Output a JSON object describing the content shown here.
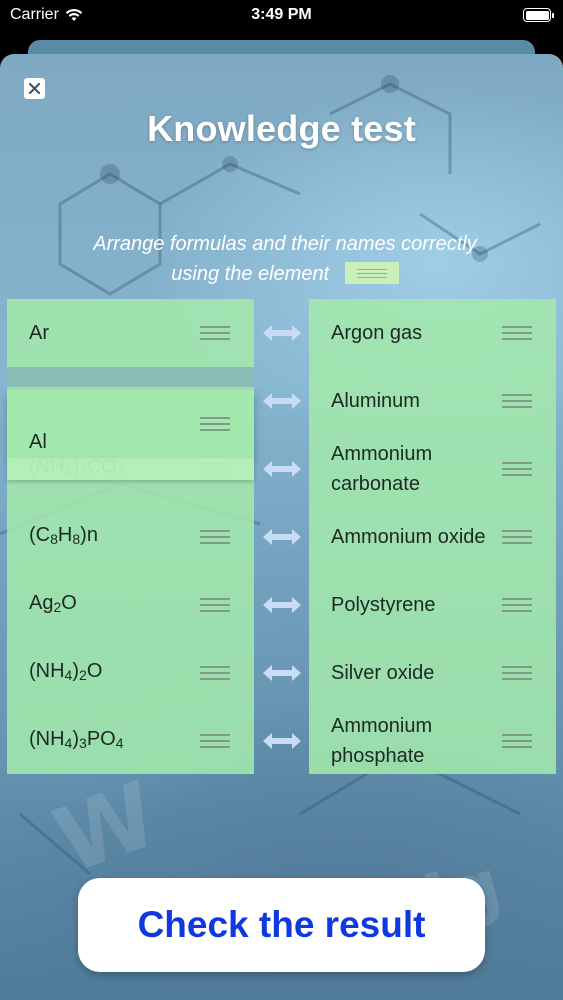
{
  "status": {
    "carrier": "Carrier",
    "time": "3:49 PM"
  },
  "header": {
    "title": "Knowledge test"
  },
  "instruction": {
    "line1": "Arrange formulas and their names correctly",
    "line2": "using the element"
  },
  "formulas": [
    {
      "id": "ar",
      "text": "Ar"
    },
    {
      "id": "al",
      "text": "Al"
    },
    {
      "id": "nh4-2co3",
      "html_parts": [
        "(NH",
        "4",
        ")",
        "2",
        "CO",
        "3"
      ]
    },
    {
      "id": "c8h8n",
      "html_parts": [
        "(C",
        "8",
        "H",
        "8",
        ")n"
      ]
    },
    {
      "id": "ag2o",
      "html_parts": [
        "Ag",
        "2",
        "O"
      ]
    },
    {
      "id": "nh4-2o",
      "html_parts": [
        "(NH",
        "4",
        ")",
        "2",
        "O"
      ]
    },
    {
      "id": "nh4-3po4",
      "html_parts": [
        "(NH",
        "4",
        ")",
        "3",
        "PO",
        "4"
      ]
    }
  ],
  "names": [
    "Argon gas",
    "Aluminum",
    "Ammonium carbonate",
    "Ammonium oxide",
    "Polystyrene",
    "Silver oxide",
    "Ammonium phosphate"
  ],
  "actions": {
    "check_label": "Check the result"
  },
  "colors": {
    "cell_bg": "#a3e8ac",
    "button_text": "#1038e0",
    "arrow": "#c8dcf5"
  }
}
